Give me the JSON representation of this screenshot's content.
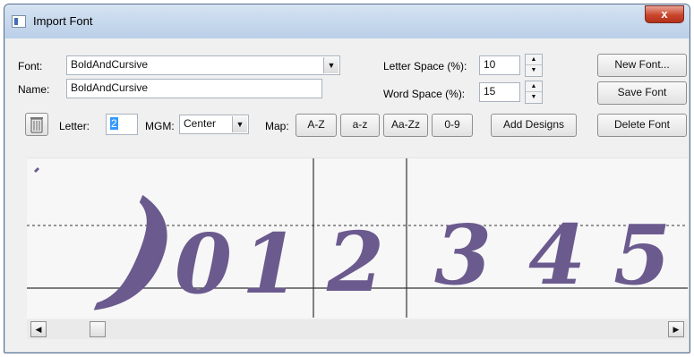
{
  "window": {
    "title": "Import Font",
    "close_glyph": "x"
  },
  "form": {
    "font_label": "Font:",
    "font_value": "BoldAndCursive",
    "name_label": "Name:",
    "name_value": "BoldAndCursive",
    "letter_space_label": "Letter Space (%):",
    "letter_space_value": "10",
    "word_space_label": "Word Space (%):",
    "word_space_value": "15"
  },
  "buttons": {
    "new_font": "New Font...",
    "save_font": "Save Font",
    "delete_font": "Delete Font",
    "add_designs": "Add Designs"
  },
  "toolbar": {
    "letter_label": "Letter:",
    "letter_value": "2",
    "mgm_label": "MGM:",
    "mgm_value": "Center",
    "map_label": "Map:",
    "map_buttons": [
      "A-Z",
      "a-z",
      "Aa-Zz",
      "0-9"
    ]
  },
  "preview": {
    "glyphs": [
      ")",
      "0",
      "1",
      "2",
      "3",
      "4",
      "5"
    ],
    "glyph_color": "#6b5a8e"
  },
  "icons": {
    "trash": "trash-icon",
    "dropdown": "▼",
    "spin_up": "▲",
    "spin_down": "▼",
    "scroll_left": "◀",
    "scroll_right": "▶"
  }
}
